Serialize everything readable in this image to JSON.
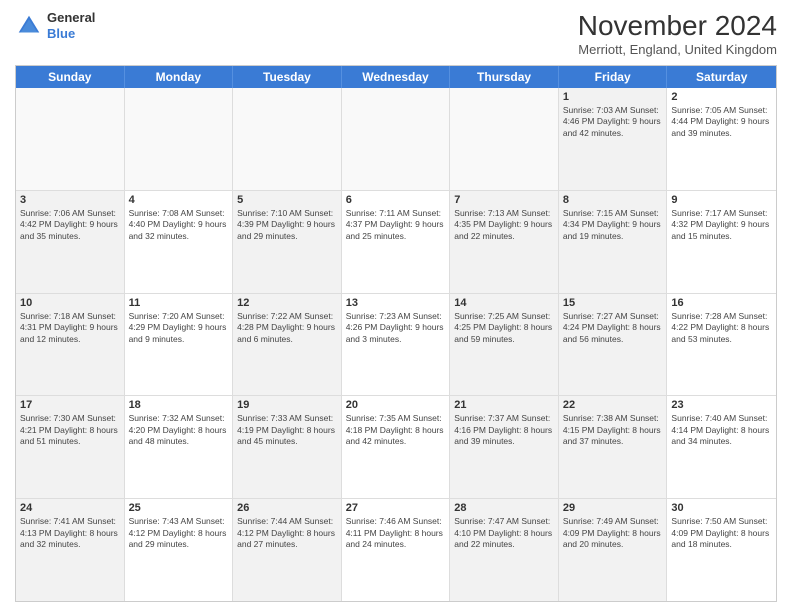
{
  "header": {
    "logo_general": "General",
    "logo_blue": "Blue",
    "month_title": "November 2024",
    "location": "Merriott, England, United Kingdom"
  },
  "weekdays": [
    "Sunday",
    "Monday",
    "Tuesday",
    "Wednesday",
    "Thursday",
    "Friday",
    "Saturday"
  ],
  "rows": [
    [
      {
        "day": "",
        "info": "",
        "empty": true
      },
      {
        "day": "",
        "info": "",
        "empty": true
      },
      {
        "day": "",
        "info": "",
        "empty": true
      },
      {
        "day": "",
        "info": "",
        "empty": true
      },
      {
        "day": "",
        "info": "",
        "empty": true
      },
      {
        "day": "1",
        "info": "Sunrise: 7:03 AM\nSunset: 4:46 PM\nDaylight: 9 hours\nand 42 minutes.",
        "shaded": true
      },
      {
        "day": "2",
        "info": "Sunrise: 7:05 AM\nSunset: 4:44 PM\nDaylight: 9 hours\nand 39 minutes.",
        "shaded": false
      }
    ],
    [
      {
        "day": "3",
        "info": "Sunrise: 7:06 AM\nSunset: 4:42 PM\nDaylight: 9 hours\nand 35 minutes.",
        "shaded": true
      },
      {
        "day": "4",
        "info": "Sunrise: 7:08 AM\nSunset: 4:40 PM\nDaylight: 9 hours\nand 32 minutes."
      },
      {
        "day": "5",
        "info": "Sunrise: 7:10 AM\nSunset: 4:39 PM\nDaylight: 9 hours\nand 29 minutes.",
        "shaded": true
      },
      {
        "day": "6",
        "info": "Sunrise: 7:11 AM\nSunset: 4:37 PM\nDaylight: 9 hours\nand 25 minutes."
      },
      {
        "day": "7",
        "info": "Sunrise: 7:13 AM\nSunset: 4:35 PM\nDaylight: 9 hours\nand 22 minutes.",
        "shaded": true
      },
      {
        "day": "8",
        "info": "Sunrise: 7:15 AM\nSunset: 4:34 PM\nDaylight: 9 hours\nand 19 minutes.",
        "shaded": true
      },
      {
        "day": "9",
        "info": "Sunrise: 7:17 AM\nSunset: 4:32 PM\nDaylight: 9 hours\nand 15 minutes."
      }
    ],
    [
      {
        "day": "10",
        "info": "Sunrise: 7:18 AM\nSunset: 4:31 PM\nDaylight: 9 hours\nand 12 minutes.",
        "shaded": true
      },
      {
        "day": "11",
        "info": "Sunrise: 7:20 AM\nSunset: 4:29 PM\nDaylight: 9 hours\nand 9 minutes."
      },
      {
        "day": "12",
        "info": "Sunrise: 7:22 AM\nSunset: 4:28 PM\nDaylight: 9 hours\nand 6 minutes.",
        "shaded": true
      },
      {
        "day": "13",
        "info": "Sunrise: 7:23 AM\nSunset: 4:26 PM\nDaylight: 9 hours\nand 3 minutes."
      },
      {
        "day": "14",
        "info": "Sunrise: 7:25 AM\nSunset: 4:25 PM\nDaylight: 8 hours\nand 59 minutes.",
        "shaded": true
      },
      {
        "day": "15",
        "info": "Sunrise: 7:27 AM\nSunset: 4:24 PM\nDaylight: 8 hours\nand 56 minutes.",
        "shaded": true
      },
      {
        "day": "16",
        "info": "Sunrise: 7:28 AM\nSunset: 4:22 PM\nDaylight: 8 hours\nand 53 minutes."
      }
    ],
    [
      {
        "day": "17",
        "info": "Sunrise: 7:30 AM\nSunset: 4:21 PM\nDaylight: 8 hours\nand 51 minutes.",
        "shaded": true
      },
      {
        "day": "18",
        "info": "Sunrise: 7:32 AM\nSunset: 4:20 PM\nDaylight: 8 hours\nand 48 minutes."
      },
      {
        "day": "19",
        "info": "Sunrise: 7:33 AM\nSunset: 4:19 PM\nDaylight: 8 hours\nand 45 minutes.",
        "shaded": true
      },
      {
        "day": "20",
        "info": "Sunrise: 7:35 AM\nSunset: 4:18 PM\nDaylight: 8 hours\nand 42 minutes."
      },
      {
        "day": "21",
        "info": "Sunrise: 7:37 AM\nSunset: 4:16 PM\nDaylight: 8 hours\nand 39 minutes.",
        "shaded": true
      },
      {
        "day": "22",
        "info": "Sunrise: 7:38 AM\nSunset: 4:15 PM\nDaylight: 8 hours\nand 37 minutes.",
        "shaded": true
      },
      {
        "day": "23",
        "info": "Sunrise: 7:40 AM\nSunset: 4:14 PM\nDaylight: 8 hours\nand 34 minutes."
      }
    ],
    [
      {
        "day": "24",
        "info": "Sunrise: 7:41 AM\nSunset: 4:13 PM\nDaylight: 8 hours\nand 32 minutes.",
        "shaded": true
      },
      {
        "day": "25",
        "info": "Sunrise: 7:43 AM\nSunset: 4:12 PM\nDaylight: 8 hours\nand 29 minutes."
      },
      {
        "day": "26",
        "info": "Sunrise: 7:44 AM\nSunset: 4:12 PM\nDaylight: 8 hours\nand 27 minutes.",
        "shaded": true
      },
      {
        "day": "27",
        "info": "Sunrise: 7:46 AM\nSunset: 4:11 PM\nDaylight: 8 hours\nand 24 minutes."
      },
      {
        "day": "28",
        "info": "Sunrise: 7:47 AM\nSunset: 4:10 PM\nDaylight: 8 hours\nand 22 minutes.",
        "shaded": true
      },
      {
        "day": "29",
        "info": "Sunrise: 7:49 AM\nSunset: 4:09 PM\nDaylight: 8 hours\nand 20 minutes.",
        "shaded": true
      },
      {
        "day": "30",
        "info": "Sunrise: 7:50 AM\nSunset: 4:09 PM\nDaylight: 8 hours\nand 18 minutes."
      }
    ]
  ]
}
